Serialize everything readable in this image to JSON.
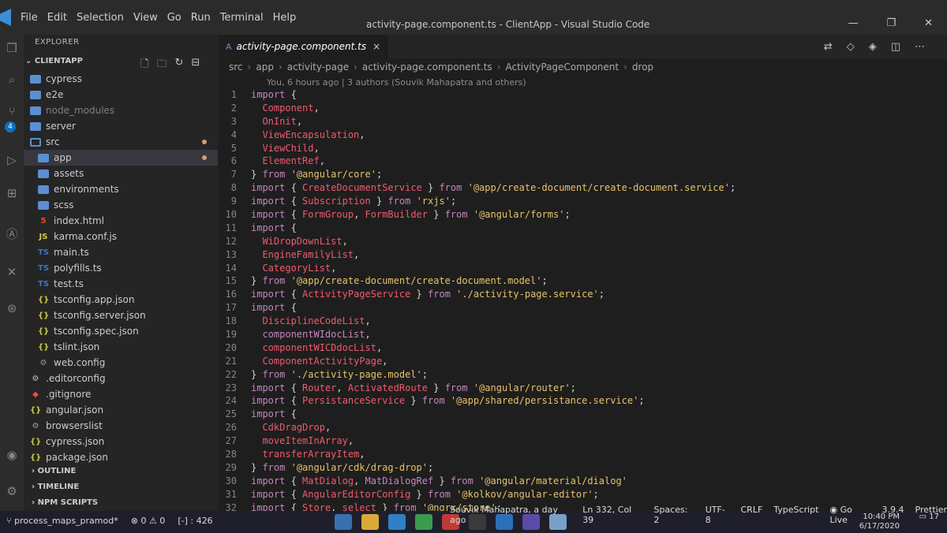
{
  "menu": [
    "File",
    "Edit",
    "Selection",
    "View",
    "Go",
    "Run",
    "Terminal",
    "Help"
  ],
  "window_title": "activity-page.component.ts - ClientApp - Visual Studio Code",
  "window_controls": [
    "—",
    "❐",
    "✕"
  ],
  "explorer": {
    "title": "EXPLORER",
    "section": "CLIENTAPP",
    "actions": [
      "new-file-icon",
      "new-folder-icon",
      "refresh-icon",
      "collapse-icon"
    ],
    "items": [
      {
        "label": "cypress",
        "type": "folder",
        "indent": 1
      },
      {
        "label": "e2e",
        "type": "folder",
        "indent": 1
      },
      {
        "label": "node_modules",
        "type": "folder",
        "indent": 1,
        "dim": true
      },
      {
        "label": "server",
        "type": "folder",
        "indent": 1
      },
      {
        "label": "src",
        "type": "folder-open",
        "indent": 1,
        "dot": true
      },
      {
        "label": "app",
        "type": "folder",
        "indent": 2,
        "selected": true,
        "dot": true
      },
      {
        "label": "assets",
        "type": "folder",
        "indent": 2
      },
      {
        "label": "environments",
        "type": "folder",
        "indent": 2
      },
      {
        "label": "scss",
        "type": "folder",
        "indent": 2
      },
      {
        "label": "index.html",
        "type": "html",
        "indent": 2
      },
      {
        "label": "karma.conf.js",
        "type": "js",
        "indent": 2
      },
      {
        "label": "main.ts",
        "type": "ts",
        "indent": 2
      },
      {
        "label": "polyfills.ts",
        "type": "ts",
        "indent": 2
      },
      {
        "label": "test.ts",
        "type": "ts",
        "indent": 2
      },
      {
        "label": "tsconfig.app.json",
        "type": "json",
        "indent": 2
      },
      {
        "label": "tsconfig.server.json",
        "type": "json",
        "indent": 2
      },
      {
        "label": "tsconfig.spec.json",
        "type": "json",
        "indent": 2
      },
      {
        "label": "tslint.json",
        "type": "json",
        "indent": 2
      },
      {
        "label": "web.config",
        "type": "config",
        "indent": 2
      },
      {
        "label": ".editorconfig",
        "type": "editorconfig",
        "indent": 1
      },
      {
        "label": ".gitignore",
        "type": "git",
        "indent": 1
      },
      {
        "label": "angular.json",
        "type": "json",
        "indent": 1
      },
      {
        "label": "browserslist",
        "type": "config",
        "indent": 1
      },
      {
        "label": "cypress.json",
        "type": "json",
        "indent": 1
      },
      {
        "label": "package.json",
        "type": "json",
        "indent": 1
      }
    ],
    "bottom_sections": [
      "OUTLINE",
      "TIMELINE",
      "NPM SCRIPTS"
    ]
  },
  "tab": {
    "label": "activity-page.component.ts",
    "icon": "A",
    "close": "×"
  },
  "breadcrumb": [
    "src",
    "app",
    "activity-page",
    "activity-page.component.ts",
    "ActivityPageComponent",
    "drop"
  ],
  "codelens": "You, 6 hours ago | 3 authors (Souvik Mahapatra and others)",
  "code": [
    {
      "n": "1",
      "parts": [
        [
          "kw",
          "import"
        ],
        [
          "pn",
          " {"
        ]
      ]
    },
    {
      "n": "2",
      "parts": [
        [
          "pn",
          "  "
        ],
        [
          "id",
          "Component"
        ],
        [
          "pn",
          ","
        ]
      ]
    },
    {
      "n": "3",
      "parts": [
        [
          "pn",
          "  "
        ],
        [
          "id",
          "OnInit"
        ],
        [
          "pn",
          ","
        ]
      ]
    },
    {
      "n": "4",
      "parts": [
        [
          "pn",
          "  "
        ],
        [
          "id",
          "ViewEncapsulation"
        ],
        [
          "pn",
          ","
        ]
      ]
    },
    {
      "n": "5",
      "parts": [
        [
          "pn",
          "  "
        ],
        [
          "id",
          "ViewChild"
        ],
        [
          "pn",
          ","
        ]
      ]
    },
    {
      "n": "6",
      "parts": [
        [
          "pn",
          "  "
        ],
        [
          "id",
          "ElementRef"
        ],
        [
          "pn",
          ","
        ]
      ]
    },
    {
      "n": "7",
      "parts": [
        [
          "pn",
          "} "
        ],
        [
          "kw",
          "from"
        ],
        [
          "pn",
          " "
        ],
        [
          "str",
          "'@angular/core'"
        ],
        [
          "pn",
          ";"
        ]
      ]
    },
    {
      "n": "8",
      "parts": [
        [
          "kw",
          "import"
        ],
        [
          "pn",
          " { "
        ],
        [
          "id",
          "CreateDocumentService"
        ],
        [
          "pn",
          " } "
        ],
        [
          "kw",
          "from"
        ],
        [
          "pn",
          " "
        ],
        [
          "str",
          "'@app/create-document/create-document.service'"
        ],
        [
          "pn",
          ";"
        ]
      ]
    },
    {
      "n": "9",
      "parts": [
        [
          "kw",
          "import"
        ],
        [
          "pn",
          " { "
        ],
        [
          "id",
          "Subscription"
        ],
        [
          "pn",
          " } "
        ],
        [
          "kw",
          "from"
        ],
        [
          "pn",
          " "
        ],
        [
          "str",
          "'rxjs'"
        ],
        [
          "pn",
          ";"
        ]
      ]
    },
    {
      "n": "10",
      "parts": [
        [
          "kw",
          "import"
        ],
        [
          "pn",
          " { "
        ],
        [
          "id",
          "FormGroup"
        ],
        [
          "pn",
          ", "
        ],
        [
          "id",
          "FormBuilder"
        ],
        [
          "pn",
          " } "
        ],
        [
          "kw",
          "from"
        ],
        [
          "pn",
          " "
        ],
        [
          "str",
          "'@angular/forms'"
        ],
        [
          "pn",
          ";"
        ]
      ]
    },
    {
      "n": "11",
      "parts": [
        [
          "kw",
          "import"
        ],
        [
          "pn",
          " {"
        ]
      ]
    },
    {
      "n": "12",
      "parts": [
        [
          "pn",
          "  "
        ],
        [
          "id",
          "WiDropDownList"
        ],
        [
          "pn",
          ","
        ]
      ]
    },
    {
      "n": "13",
      "parts": [
        [
          "pn",
          "  "
        ],
        [
          "id",
          "EngineFamilyList"
        ],
        [
          "pn",
          ","
        ]
      ]
    },
    {
      "n": "14",
      "parts": [
        [
          "pn",
          "  "
        ],
        [
          "id",
          "CategoryList"
        ],
        [
          "pn",
          ","
        ]
      ]
    },
    {
      "n": "15",
      "parts": [
        [
          "pn",
          "} "
        ],
        [
          "kw",
          "from"
        ],
        [
          "pn",
          " "
        ],
        [
          "str",
          "'@app/create-document/create-document.model'"
        ],
        [
          "pn",
          ";"
        ]
      ]
    },
    {
      "n": "16",
      "parts": [
        [
          "kw",
          "import"
        ],
        [
          "pn",
          " { "
        ],
        [
          "id",
          "ActivityPageService"
        ],
        [
          "pn",
          " } "
        ],
        [
          "kw",
          "from"
        ],
        [
          "pn",
          " "
        ],
        [
          "str",
          "'./activity-page.service'"
        ],
        [
          "pn",
          ";"
        ]
      ]
    },
    {
      "n": "17",
      "parts": [
        [
          "kw",
          "import"
        ],
        [
          "pn",
          " {"
        ]
      ]
    },
    {
      "n": "18",
      "parts": [
        [
          "pn",
          "  "
        ],
        [
          "id",
          "DisciplineCodeList"
        ],
        [
          "pn",
          ","
        ]
      ]
    },
    {
      "n": "19",
      "parts": [
        [
          "pn",
          "  "
        ],
        [
          "kw",
          "componentWIdocList"
        ],
        [
          "pn",
          ","
        ]
      ]
    },
    {
      "n": "20",
      "parts": [
        [
          "pn",
          "  "
        ],
        [
          "id",
          "componentWICDdocList"
        ],
        [
          "pn",
          ","
        ]
      ]
    },
    {
      "n": "21",
      "parts": [
        [
          "pn",
          "  "
        ],
        [
          "id",
          "ComponentActivityPage"
        ],
        [
          "pn",
          ","
        ]
      ]
    },
    {
      "n": "22",
      "parts": [
        [
          "pn",
          "} "
        ],
        [
          "kw",
          "from"
        ],
        [
          "pn",
          " "
        ],
        [
          "str",
          "'./activity-page.model'"
        ],
        [
          "pn",
          ";"
        ]
      ]
    },
    {
      "n": "23",
      "parts": [
        [
          "kw",
          "import"
        ],
        [
          "pn",
          " { "
        ],
        [
          "id",
          "Router"
        ],
        [
          "pn",
          ", "
        ],
        [
          "id",
          "ActivatedRoute"
        ],
        [
          "pn",
          " } "
        ],
        [
          "kw",
          "from"
        ],
        [
          "pn",
          " "
        ],
        [
          "str",
          "'@angular/router'"
        ],
        [
          "pn",
          ";"
        ]
      ]
    },
    {
      "n": "24",
      "parts": [
        [
          "kw",
          "import"
        ],
        [
          "pn",
          " { "
        ],
        [
          "id",
          "PersistanceService"
        ],
        [
          "pn",
          " } "
        ],
        [
          "kw",
          "from"
        ],
        [
          "pn",
          " "
        ],
        [
          "str",
          "'@app/shared/persistance.service'"
        ],
        [
          "pn",
          ";"
        ]
      ]
    },
    {
      "n": "25",
      "parts": [
        [
          "kw",
          "import"
        ],
        [
          "pn",
          " {"
        ]
      ]
    },
    {
      "n": "26",
      "parts": [
        [
          "pn",
          "  "
        ],
        [
          "id",
          "CdkDragDrop"
        ],
        [
          "pn",
          ","
        ]
      ]
    },
    {
      "n": "27",
      "parts": [
        [
          "pn",
          "  "
        ],
        [
          "id",
          "moveItemInArray"
        ],
        [
          "pn",
          ","
        ]
      ]
    },
    {
      "n": "28",
      "parts": [
        [
          "pn",
          "  "
        ],
        [
          "id",
          "transferArrayItem"
        ],
        [
          "pn",
          ","
        ]
      ]
    },
    {
      "n": "29",
      "parts": [
        [
          "pn",
          "} "
        ],
        [
          "kw",
          "from"
        ],
        [
          "pn",
          " "
        ],
        [
          "str",
          "'@angular/cdk/drag-drop'"
        ],
        [
          "pn",
          ";"
        ]
      ]
    },
    {
      "n": "30",
      "parts": [
        [
          "kw",
          "import"
        ],
        [
          "pn",
          " { "
        ],
        [
          "id",
          "MatDialog"
        ],
        [
          "pn",
          ", "
        ],
        [
          "kw",
          "MatDialogRef"
        ],
        [
          "pn",
          " } "
        ],
        [
          "kw",
          "from"
        ],
        [
          "pn",
          " "
        ],
        [
          "str",
          "'@angular/material/dialog'"
        ]
      ]
    },
    {
      "n": "31",
      "parts": [
        [
          "kw",
          "import"
        ],
        [
          "pn",
          " { "
        ],
        [
          "id",
          "AngularEditorConfig"
        ],
        [
          "pn",
          " } "
        ],
        [
          "kw",
          "from"
        ],
        [
          "pn",
          " "
        ],
        [
          "str",
          "'@kolkov/angular-editor'"
        ],
        [
          "pn",
          ";"
        ]
      ]
    },
    {
      "n": "32",
      "parts": [
        [
          "kw",
          "import"
        ],
        [
          "pn",
          " { "
        ],
        [
          "id",
          "Store"
        ],
        [
          "pn",
          ", "
        ],
        [
          "id",
          "select"
        ],
        [
          "pn",
          " } "
        ],
        [
          "kw",
          "from"
        ],
        [
          "pn",
          " "
        ],
        [
          "str",
          "'@ngrx/store'"
        ],
        [
          "pn",
          ";"
        ]
      ]
    }
  ],
  "status": {
    "branch": "process_maps_pramod*",
    "problems": "⊗ 0 ⚠ 0",
    "lines": "[-] : 426",
    "blame": "Souvik Mahapatra, a day ago",
    "position": "Ln 332, Col 39",
    "spaces": "Spaces: 2",
    "encoding": "UTF-8",
    "eol": "CRLF",
    "language": "TypeScript",
    "golive": "Go Live",
    "version": "3.9.4",
    "prettier": "Prettier",
    "time": "10:40 PM",
    "date": "6/17/2020",
    "notifications": "17"
  },
  "colors": {
    "keyword": "#c586c0",
    "identifier": "#f05a6e",
    "string": "#e8c26a",
    "accent": "#0e70c0"
  }
}
